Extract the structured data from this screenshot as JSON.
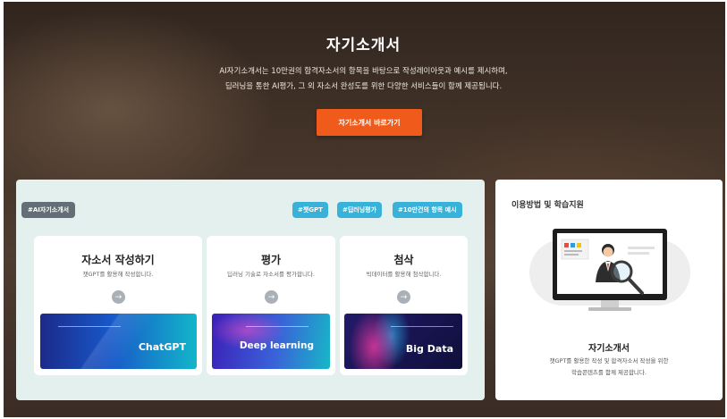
{
  "hero": {
    "title": "자기소개서",
    "desc_line1": "AI자기소개서는 10만권의 합격자소서의 항목을 바탕으로 작성레이아웃과 예시를 제시하며,",
    "desc_line2": "딥러닝을 통한 AI평가, 그 외 자소서 완성도를 위한 다양한 서비스들이 함께 제공됩니다.",
    "cta_label": "자기소개서 바로가기"
  },
  "panel": {
    "main_tag": "#AI자기소개서",
    "tags": [
      "#챗GPT",
      "#딥러닝평가",
      "#10만건의 항목 예시"
    ],
    "cards": [
      {
        "title": "자소서 작성하기",
        "subtitle": "챗GPT를 활용해 작성합니다.",
        "arrow": "→",
        "thumb_label": "ChatGPT"
      },
      {
        "title": "평가",
        "subtitle": "딥러닝 기술로 자소서를 평가합니다.",
        "arrow": "→",
        "thumb_label": "Deep learning"
      },
      {
        "title": "첨삭",
        "subtitle": "빅데이터를 활용해 첨삭합니다.",
        "arrow": "→",
        "thumb_label": "Big Data"
      }
    ]
  },
  "side": {
    "title": "이용방법 및 학습지원",
    "name": "자기소개서",
    "desc_line1": "챗GPT를 활용한 작성 및 합격자소서 작성을 위한",
    "desc_line2": "학습콘텐츠를 함께 제공합니다."
  },
  "colors": {
    "cta": "#f05a1a",
    "tag": "#39b2d9",
    "main_tag": "#646e77",
    "panel_bg": "#e4f0ee"
  },
  "icons": {
    "card_arrow": "arrow-right-icon",
    "illustration": "monitor-person-magnifier-illustration"
  }
}
